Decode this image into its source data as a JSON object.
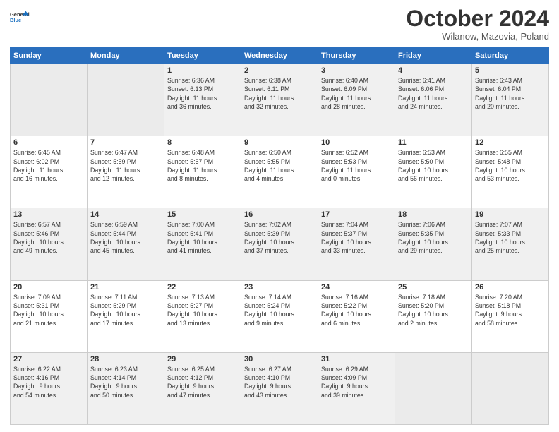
{
  "header": {
    "logo_line1": "General",
    "logo_line2": "Blue",
    "title": "October 2024",
    "location": "Wilanow, Mazovia, Poland"
  },
  "weekdays": [
    "Sunday",
    "Monday",
    "Tuesday",
    "Wednesday",
    "Thursday",
    "Friday",
    "Saturday"
  ],
  "weeks": [
    [
      {
        "day": "",
        "info": ""
      },
      {
        "day": "",
        "info": ""
      },
      {
        "day": "1",
        "info": "Sunrise: 6:36 AM\nSunset: 6:13 PM\nDaylight: 11 hours\nand 36 minutes."
      },
      {
        "day": "2",
        "info": "Sunrise: 6:38 AM\nSunset: 6:11 PM\nDaylight: 11 hours\nand 32 minutes."
      },
      {
        "day": "3",
        "info": "Sunrise: 6:40 AM\nSunset: 6:09 PM\nDaylight: 11 hours\nand 28 minutes."
      },
      {
        "day": "4",
        "info": "Sunrise: 6:41 AM\nSunset: 6:06 PM\nDaylight: 11 hours\nand 24 minutes."
      },
      {
        "day": "5",
        "info": "Sunrise: 6:43 AM\nSunset: 6:04 PM\nDaylight: 11 hours\nand 20 minutes."
      }
    ],
    [
      {
        "day": "6",
        "info": "Sunrise: 6:45 AM\nSunset: 6:02 PM\nDaylight: 11 hours\nand 16 minutes."
      },
      {
        "day": "7",
        "info": "Sunrise: 6:47 AM\nSunset: 5:59 PM\nDaylight: 11 hours\nand 12 minutes."
      },
      {
        "day": "8",
        "info": "Sunrise: 6:48 AM\nSunset: 5:57 PM\nDaylight: 11 hours\nand 8 minutes."
      },
      {
        "day": "9",
        "info": "Sunrise: 6:50 AM\nSunset: 5:55 PM\nDaylight: 11 hours\nand 4 minutes."
      },
      {
        "day": "10",
        "info": "Sunrise: 6:52 AM\nSunset: 5:53 PM\nDaylight: 11 hours\nand 0 minutes."
      },
      {
        "day": "11",
        "info": "Sunrise: 6:53 AM\nSunset: 5:50 PM\nDaylight: 10 hours\nand 56 minutes."
      },
      {
        "day": "12",
        "info": "Sunrise: 6:55 AM\nSunset: 5:48 PM\nDaylight: 10 hours\nand 53 minutes."
      }
    ],
    [
      {
        "day": "13",
        "info": "Sunrise: 6:57 AM\nSunset: 5:46 PM\nDaylight: 10 hours\nand 49 minutes."
      },
      {
        "day": "14",
        "info": "Sunrise: 6:59 AM\nSunset: 5:44 PM\nDaylight: 10 hours\nand 45 minutes."
      },
      {
        "day": "15",
        "info": "Sunrise: 7:00 AM\nSunset: 5:41 PM\nDaylight: 10 hours\nand 41 minutes."
      },
      {
        "day": "16",
        "info": "Sunrise: 7:02 AM\nSunset: 5:39 PM\nDaylight: 10 hours\nand 37 minutes."
      },
      {
        "day": "17",
        "info": "Sunrise: 7:04 AM\nSunset: 5:37 PM\nDaylight: 10 hours\nand 33 minutes."
      },
      {
        "day": "18",
        "info": "Sunrise: 7:06 AM\nSunset: 5:35 PM\nDaylight: 10 hours\nand 29 minutes."
      },
      {
        "day": "19",
        "info": "Sunrise: 7:07 AM\nSunset: 5:33 PM\nDaylight: 10 hours\nand 25 minutes."
      }
    ],
    [
      {
        "day": "20",
        "info": "Sunrise: 7:09 AM\nSunset: 5:31 PM\nDaylight: 10 hours\nand 21 minutes."
      },
      {
        "day": "21",
        "info": "Sunrise: 7:11 AM\nSunset: 5:29 PM\nDaylight: 10 hours\nand 17 minutes."
      },
      {
        "day": "22",
        "info": "Sunrise: 7:13 AM\nSunset: 5:27 PM\nDaylight: 10 hours\nand 13 minutes."
      },
      {
        "day": "23",
        "info": "Sunrise: 7:14 AM\nSunset: 5:24 PM\nDaylight: 10 hours\nand 9 minutes."
      },
      {
        "day": "24",
        "info": "Sunrise: 7:16 AM\nSunset: 5:22 PM\nDaylight: 10 hours\nand 6 minutes."
      },
      {
        "day": "25",
        "info": "Sunrise: 7:18 AM\nSunset: 5:20 PM\nDaylight: 10 hours\nand 2 minutes."
      },
      {
        "day": "26",
        "info": "Sunrise: 7:20 AM\nSunset: 5:18 PM\nDaylight: 9 hours\nand 58 minutes."
      }
    ],
    [
      {
        "day": "27",
        "info": "Sunrise: 6:22 AM\nSunset: 4:16 PM\nDaylight: 9 hours\nand 54 minutes."
      },
      {
        "day": "28",
        "info": "Sunrise: 6:23 AM\nSunset: 4:14 PM\nDaylight: 9 hours\nand 50 minutes."
      },
      {
        "day": "29",
        "info": "Sunrise: 6:25 AM\nSunset: 4:12 PM\nDaylight: 9 hours\nand 47 minutes."
      },
      {
        "day": "30",
        "info": "Sunrise: 6:27 AM\nSunset: 4:10 PM\nDaylight: 9 hours\nand 43 minutes."
      },
      {
        "day": "31",
        "info": "Sunrise: 6:29 AM\nSunset: 4:09 PM\nDaylight: 9 hours\nand 39 minutes."
      },
      {
        "day": "",
        "info": ""
      },
      {
        "day": "",
        "info": ""
      }
    ]
  ]
}
